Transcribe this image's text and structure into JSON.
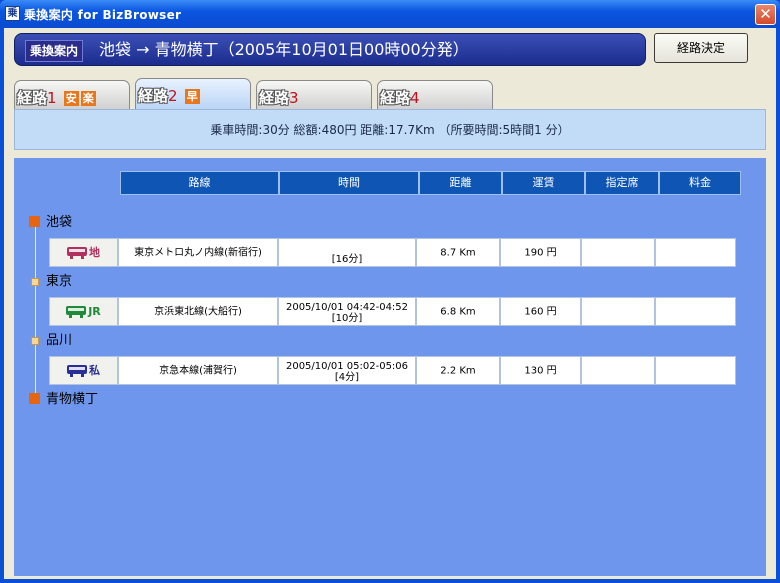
{
  "window": {
    "title": "乗換案内 for BizBrowser",
    "app_icon_glyph": "乗",
    "close_glyph": "✕"
  },
  "header": {
    "badge": "乗換案内",
    "route": "池袋 → 青物横丁（2005年10月01日00時00分発）"
  },
  "decide_button": "経路決定",
  "tabs": [
    {
      "prefix": "経路",
      "num": "1",
      "marks": [
        "安",
        "楽"
      ],
      "active": false
    },
    {
      "prefix": "経路",
      "num": "2",
      "marks": [
        "早"
      ],
      "active": true
    },
    {
      "prefix": "経路",
      "num": "3",
      "marks": [],
      "active": false
    },
    {
      "prefix": "経路",
      "num": "4",
      "marks": [],
      "active": false
    }
  ],
  "summary": "乗車時間:30分  総額:480円  距離:17.7Km （所要時間:5時間1 分）",
  "columns": [
    "路線",
    "時間",
    "距離",
    "運賃",
    "指定席",
    "料金"
  ],
  "stations": [
    {
      "name": "池袋",
      "kind": "terminal"
    },
    {
      "name": "東京",
      "kind": "transfer"
    },
    {
      "name": "品川",
      "kind": "transfer"
    },
    {
      "name": "青物横丁",
      "kind": "terminal"
    }
  ],
  "segments": [
    {
      "type_label": "地",
      "type_color": "#b0315d",
      "line": "東京メトロ丸ノ内線(新宿行)",
      "time_range": "",
      "duration": "[16分]",
      "distance": "8.7 Km",
      "fare": "190 円",
      "reserved": "",
      "charge": ""
    },
    {
      "type_label": "JR",
      "type_color": "#1e8a3a",
      "line": "京浜東北線(大船行)",
      "time_range": "2005/10/01 04:42-04:52",
      "duration": "[10分]",
      "distance": "6.8 Km",
      "fare": "160 円",
      "reserved": "",
      "charge": ""
    },
    {
      "type_label": "私",
      "type_color": "#2a2f96",
      "line": "京急本線(浦賀行)",
      "time_range": "2005/10/01 05:02-05:06",
      "duration": "[4分]",
      "distance": "2.2 Km",
      "fare": "130 円",
      "reserved": "",
      "charge": ""
    }
  ]
}
